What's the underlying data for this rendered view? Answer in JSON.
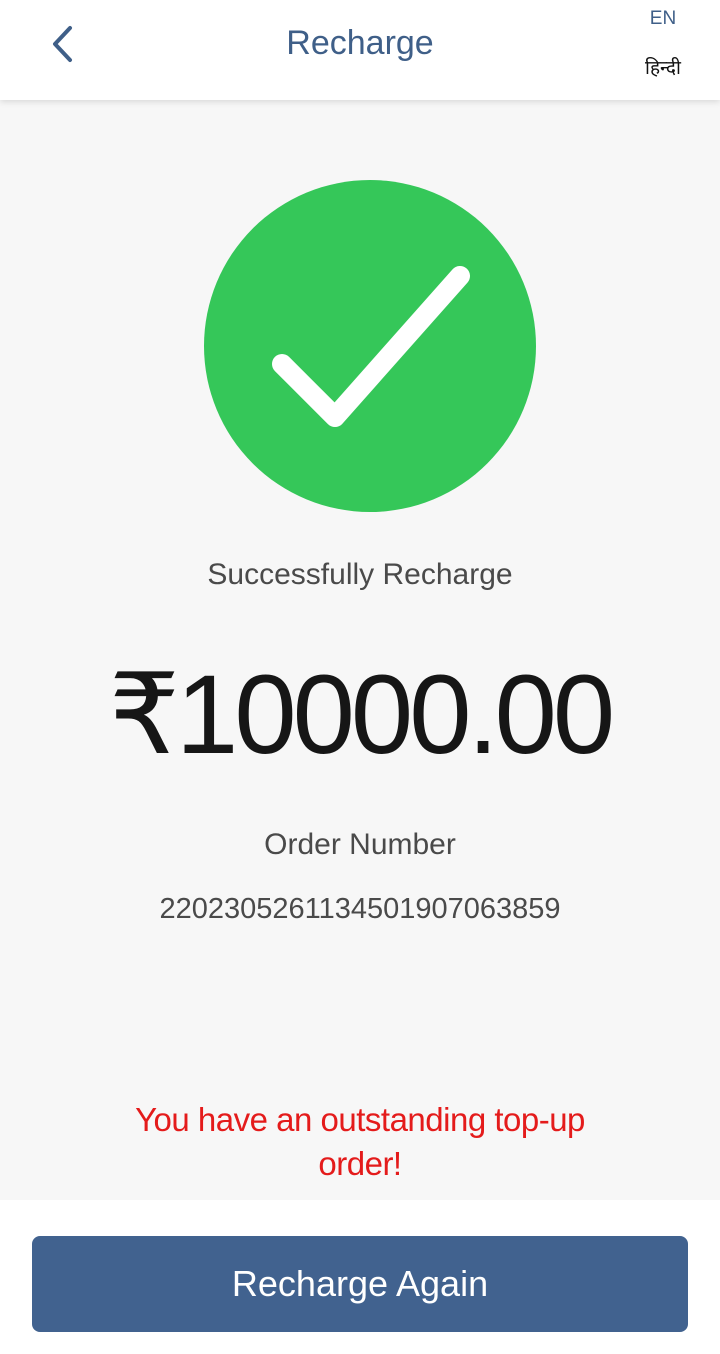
{
  "header": {
    "title": "Recharge",
    "back_icon": "chevron-left-icon",
    "lang_en": "EN",
    "lang_hi": "हिन्दी"
  },
  "status": {
    "icon": "success-check-icon",
    "message": "Successfully Recharge",
    "amount": "₹10000.00",
    "order_label": "Order Number",
    "order_number": "2202305261134501907063859"
  },
  "notice": {
    "text": "You have an outstanding top-up order!"
  },
  "actions": {
    "recharge_again_label": "Recharge Again"
  },
  "colors": {
    "accent": "#3f5f88",
    "button": "#41628f",
    "success": "#35c759",
    "warning": "#e41b1b"
  }
}
